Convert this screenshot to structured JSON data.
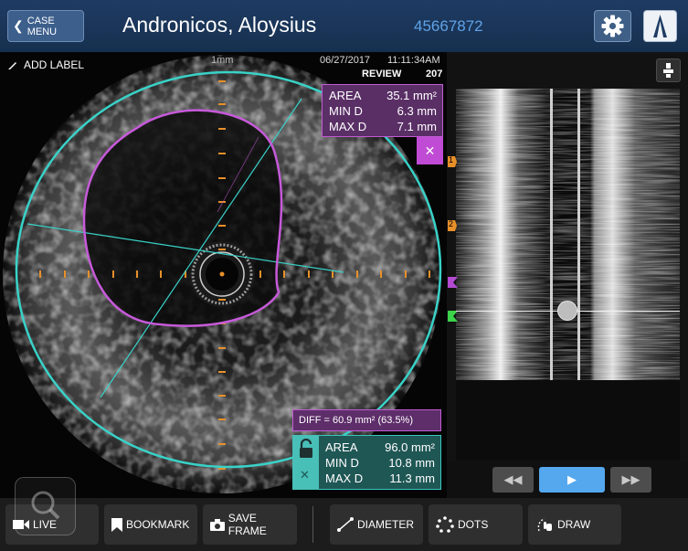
{
  "header": {
    "case_menu_label": "CASE MENU",
    "patient_name": "Andronicos, Aloysius",
    "patient_id": "45667872"
  },
  "image": {
    "add_label": "ADD LABEL",
    "scale_label": "1mm",
    "date": "06/27/2017",
    "time": "11:11:34AM",
    "mode": "REVIEW",
    "frame": "207"
  },
  "measurement_lumen": {
    "area_label": "AREA",
    "area_value": "35.1 mm²",
    "min_label": "MIN D",
    "min_value": "6.3 mm",
    "max_label": "MAX D",
    "max_value": "7.1 mm",
    "color": "#c15bd3"
  },
  "measurement_vessel": {
    "diff": "DIFF = 60.9 mm² (63.5%)",
    "area_label": "AREA",
    "area_value": "96.0 mm²",
    "min_label": "MIN D",
    "min_value": "10.8 mm",
    "max_label": "MAX D",
    "max_value": "11.3 mm",
    "color": "#39c7c0"
  },
  "lview": {
    "bookmarks": [
      {
        "label": "1",
        "color": "#e8902a"
      },
      {
        "label": "2",
        "color": "#e8902a"
      },
      {
        "label": "",
        "color": "#b34ad0"
      },
      {
        "label": "",
        "color": "#3bd34a"
      }
    ]
  },
  "playback": {
    "rewind_icon": "rewind-icon",
    "play_icon": "play-icon",
    "forward_icon": "fast-forward-icon"
  },
  "toolbar": {
    "live": "LIVE",
    "bookmark": "BOOKMARK",
    "save_frame": "SAVE FRAME",
    "diameter": "DIAMETER",
    "dots": "DOTS",
    "draw": "DRAW"
  }
}
